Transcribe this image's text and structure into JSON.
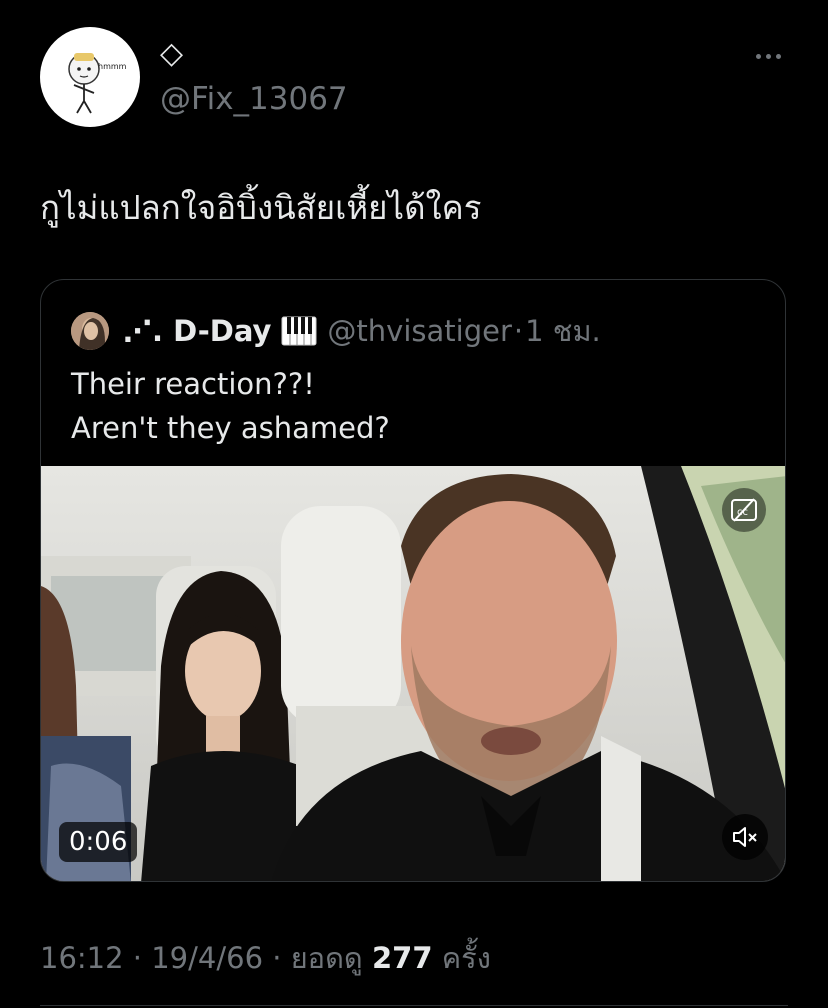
{
  "tweet": {
    "display_name": "◇",
    "handle": "@Fix_13067",
    "avatar_caption": "hmmm",
    "text": "กูไม่แปลกใจอิบิ้งนิสัยเหี้ยได้ใคร"
  },
  "quote": {
    "name": "⋰. D-Day",
    "handle": "@thvisatiger",
    "separator": "·",
    "time": "1 ชม.",
    "text_lines": [
      "Their reaction??!",
      "Aren't they ashamed?"
    ],
    "video": {
      "duration": "0:06",
      "cc_icon": "closed-captions-off-icon",
      "mute_icon": "speaker-muted-icon"
    }
  },
  "meta": {
    "time": "16:12",
    "sep1": " · ",
    "date": "19/4/66",
    "sep2": " · ",
    "views_label": "ยอดดู ",
    "views_count": "277",
    "views_suffix": " ครั้ง"
  },
  "colors": {
    "background": "#000000",
    "text": "#e7e9ea",
    "secondary": "#71767b",
    "border": "#2f3336"
  }
}
